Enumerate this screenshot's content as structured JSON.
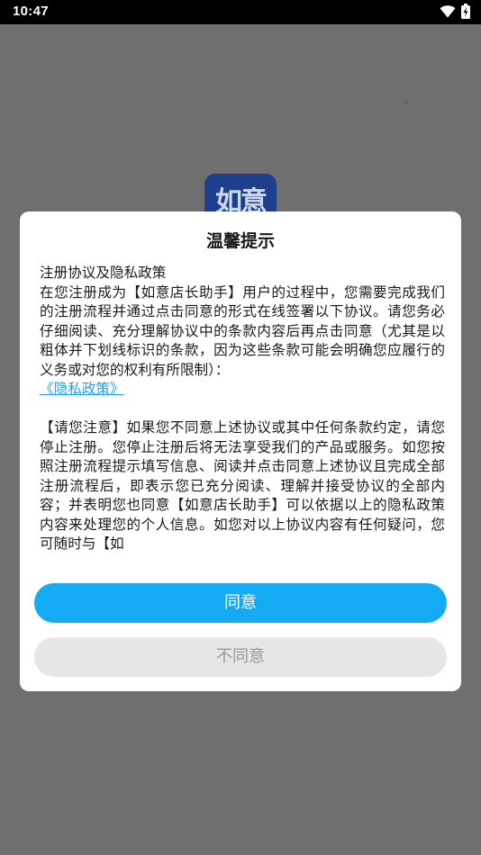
{
  "status_bar": {
    "time": "10:47",
    "icons": [
      "wifi-icon",
      "battery-charging-icon"
    ]
  },
  "background": {
    "app_logo_text": "如意"
  },
  "dialog": {
    "title": "温馨提示",
    "heading": "注册协议及隐私政策",
    "paragraph1": "在您注册成为【如意店长助手】用户的过程中，您需要完成我们的注册流程并通过点击同意的形式在线签署以下协议。请您务必仔细阅读、充分理解协议中的条款内容后再点击同意（尤其是以粗体并下划线标识的条款，因为这些条款可能会明确您应履行的义务或对您的权利有所限制）：",
    "privacy_link": "《隐私政策》",
    "paragraph2": "【请您注意】如果您不同意上述协议或其中任何条款约定，请您停止注册。您停止注册后将无法享受我们的产品或服务。如您按照注册流程提示填写信息、阅读并点击同意上述协议且完成全部注册流程后，即表示您已充分阅读、理解并接受协议的全部内容；并表明您也同意【如意店长助手】可以依据以上的隐私政策内容来处理您的个人信息。如您对以上协议内容有任何疑问，您可随时与【如",
    "agree_label": "同意",
    "disagree_label": "不同意"
  },
  "colors": {
    "accent": "#15abf4",
    "link": "#1aa3e6",
    "overlay": "#6f6f6f",
    "disabled_button": "#e6e6e6"
  }
}
